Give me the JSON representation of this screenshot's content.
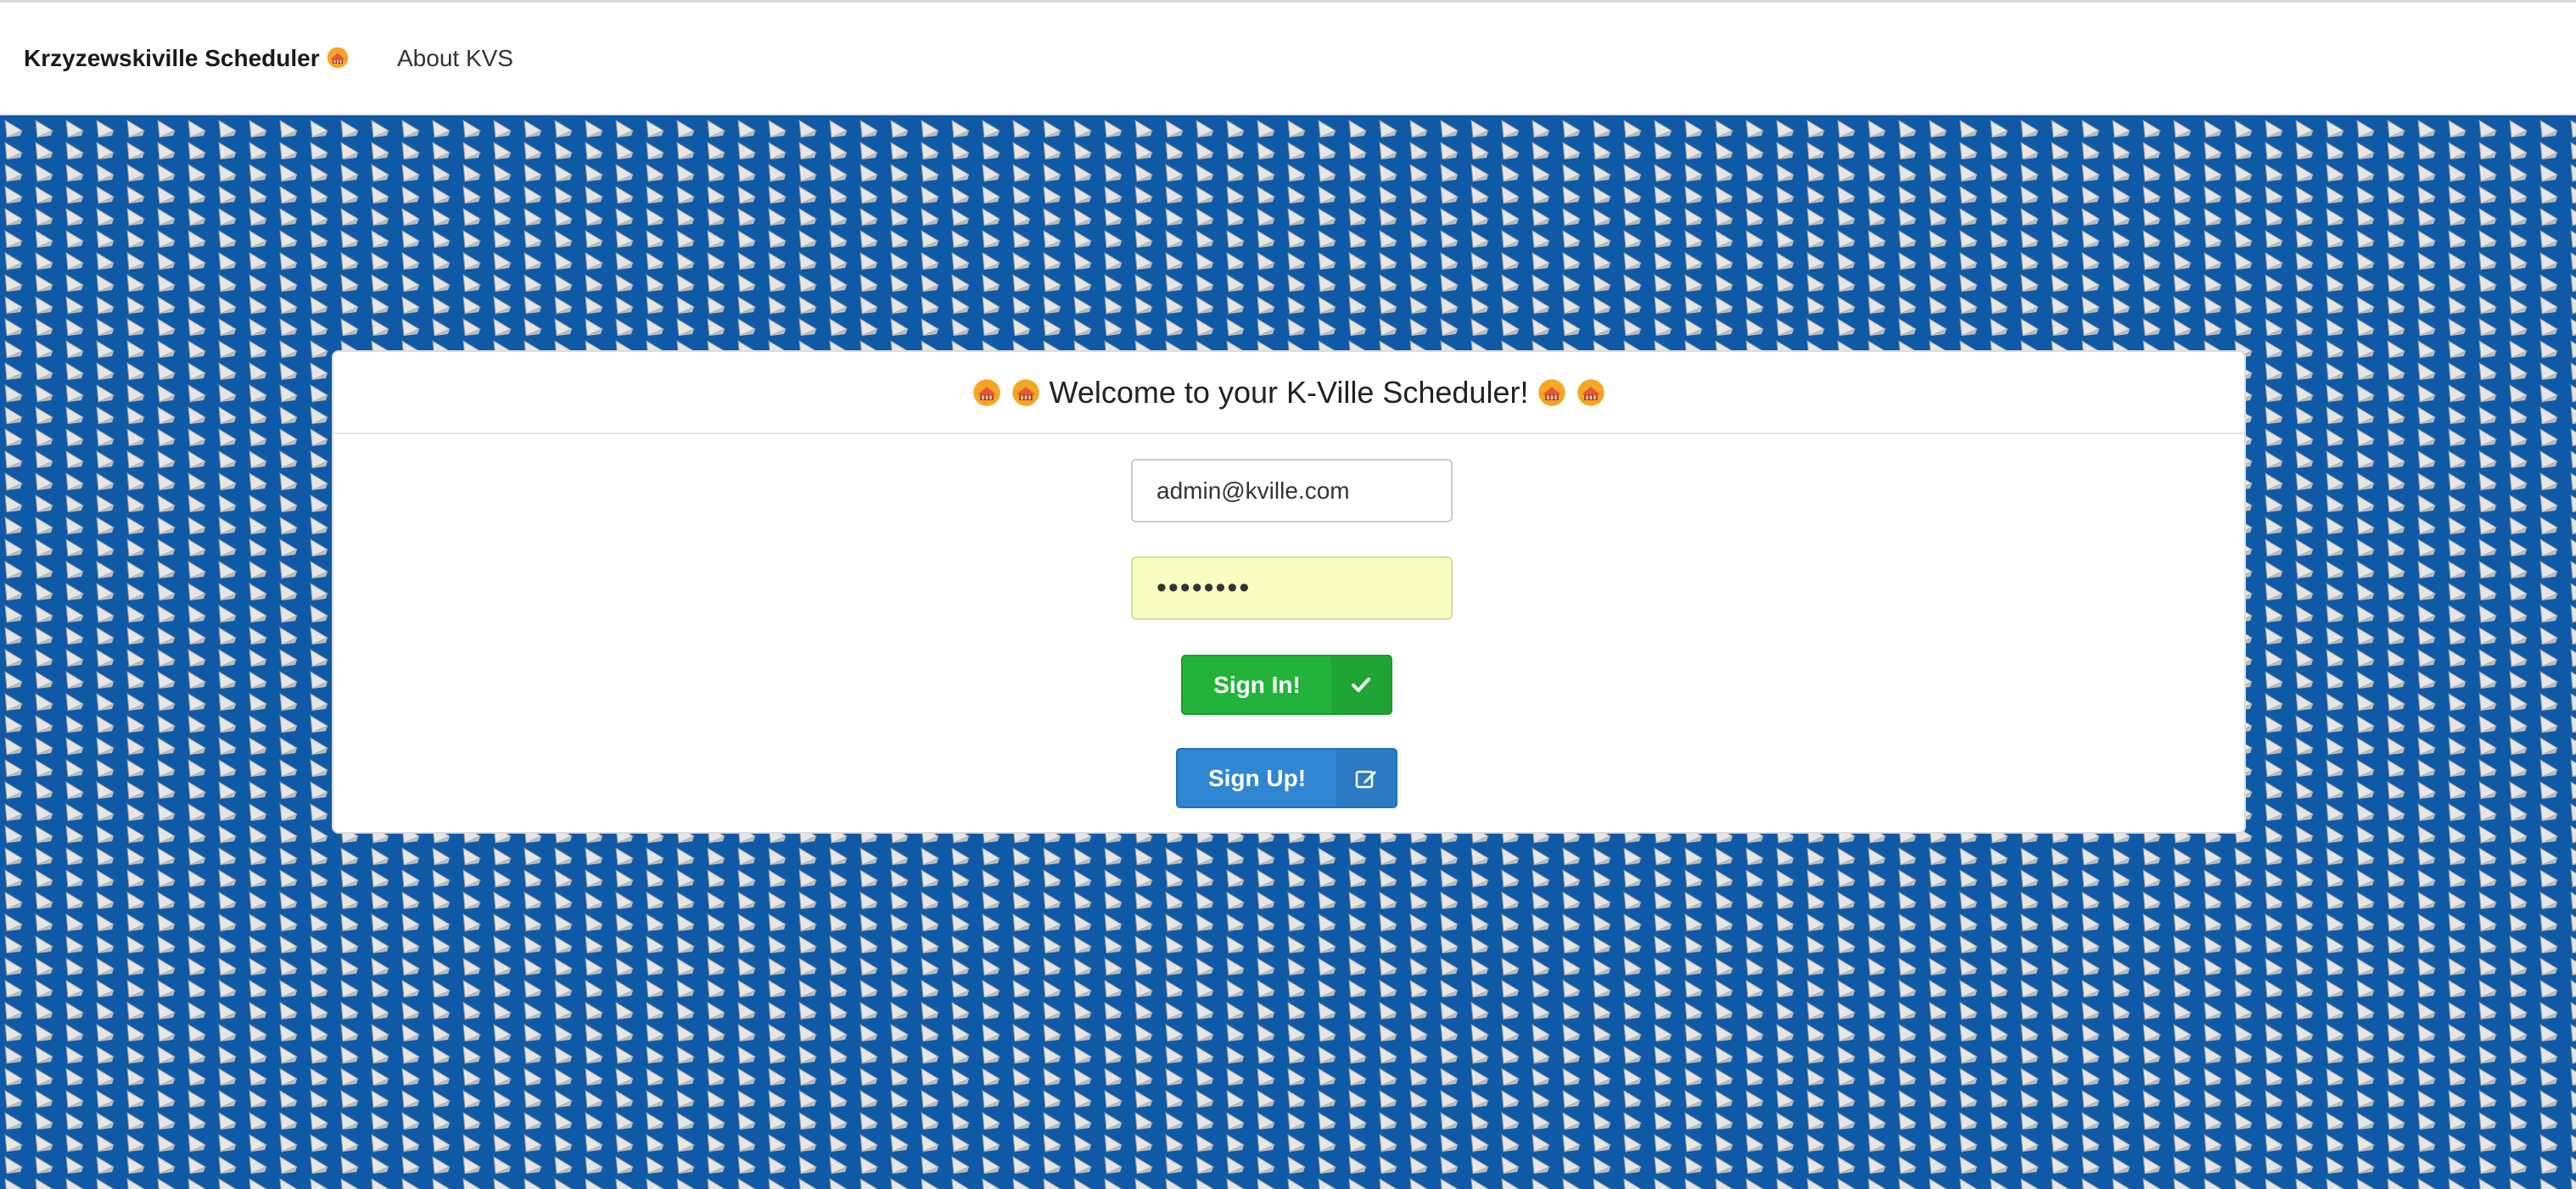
{
  "navbar": {
    "brand": "Krzyzewskiville Scheduler",
    "brand_emoji": "grimacing-tent-emoji",
    "about_link": "About KVS"
  },
  "login": {
    "title": "Welcome to your K-Ville Scheduler!",
    "title_emoji": "grimacing-tent-emoji",
    "email_value": "admin@kville.com",
    "password_value": "••••••••",
    "signin_label": "Sign In!",
    "signin_icon": "check-icon",
    "signup_label": "Sign Up!",
    "signup_icon": "edit-icon"
  },
  "colors": {
    "background": "#0f5aa6",
    "signin": "#23b33a",
    "signup": "#2f86d3",
    "password_autofill": "#fafdc2"
  }
}
